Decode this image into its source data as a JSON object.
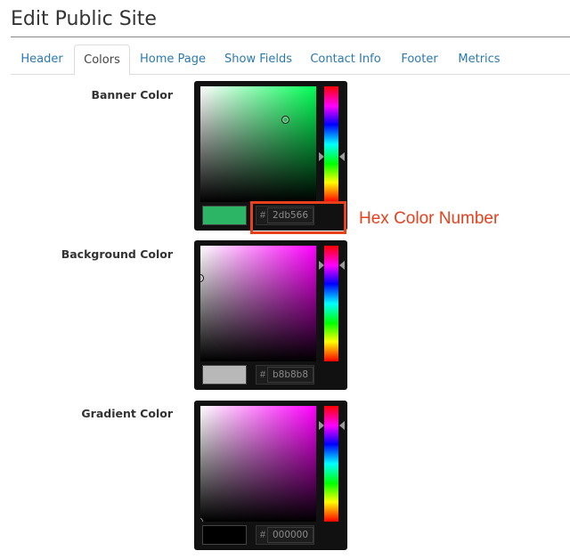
{
  "page": {
    "title": "Edit Public Site"
  },
  "tabs": [
    {
      "label": "Header",
      "active": false
    },
    {
      "label": "Colors",
      "active": true
    },
    {
      "label": "Home Page",
      "active": false
    },
    {
      "label": "Show Fields",
      "active": false
    },
    {
      "label": "Contact Info",
      "active": false
    },
    {
      "label": "Footer",
      "active": false
    },
    {
      "label": "Metrics",
      "active": false
    }
  ],
  "pickers": [
    {
      "label": "Banner Color",
      "hash": "#",
      "hex": "2db566",
      "swatch": "#2db566",
      "hue_color": "#00ff55"
    },
    {
      "label": "Background Color",
      "hash": "#",
      "hex": "b8b8b8",
      "swatch": "#b8b8b8",
      "hue_color": "#ff00ff"
    },
    {
      "label": "Gradient Color",
      "hash": "#",
      "hex": "000000",
      "swatch": "#000000",
      "hue_color": "#ff00ff"
    }
  ],
  "annotation": {
    "text": "Hex Color Number",
    "color": "#e8401c"
  }
}
